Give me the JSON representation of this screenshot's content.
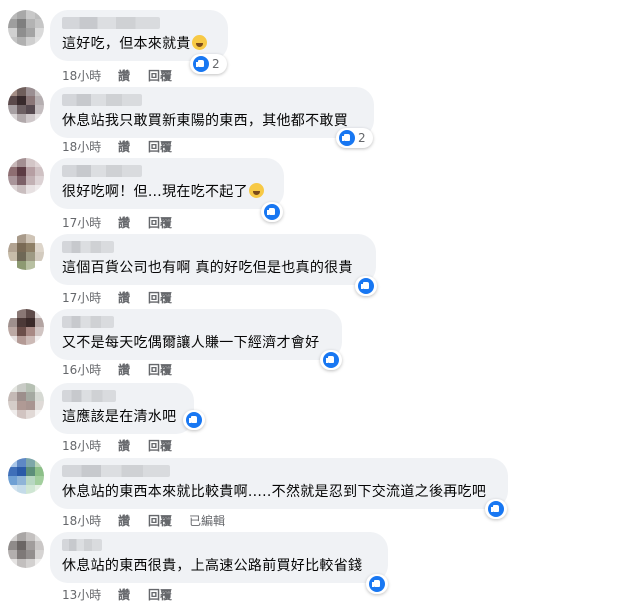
{
  "labels": {
    "like": "讚",
    "reply": "回覆"
  },
  "comments": [
    {
      "text": "這好吃，但本來就貴",
      "emoji": "laughing-emoji",
      "time": "18小時",
      "reactions": "2",
      "edited": ""
    },
    {
      "text": "休息站我只敢買新東陽的東西，其他都不敢買",
      "emoji": "",
      "time": "18小時",
      "reactions": "2",
      "edited": ""
    },
    {
      "text": "很好吃啊！但…現在吃不起了",
      "emoji": "crying-emoji",
      "time": "17小時",
      "reactions": "",
      "edited": ""
    },
    {
      "text": "這個百貨公司也有啊 真的好吃但是也真的很貴",
      "emoji": "",
      "time": "17小時",
      "reactions": "",
      "edited": ""
    },
    {
      "text": "又不是每天吃偶爾讓人賺一下經濟才會好",
      "emoji": "",
      "time": "16小時",
      "reactions": "",
      "edited": ""
    },
    {
      "text": "這應該是在清水吧",
      "emoji": "",
      "time": "18小時",
      "reactions": "",
      "edited": ""
    },
    {
      "text": "休息站的東西本來就比較貴啊.....不然就是忍到下交流道之後再吃吧",
      "emoji": "",
      "time": "18小時",
      "reactions": "",
      "edited": "已編輯"
    },
    {
      "text": "休息站的東西很貴，上高速公路前買好比較省錢",
      "emoji": "",
      "time": "13小時",
      "reactions": "",
      "edited": ""
    }
  ],
  "colors": {
    "bubble": "#f0f2f5",
    "like_blue": "#1877f2",
    "meta_gray": "#65676b"
  }
}
